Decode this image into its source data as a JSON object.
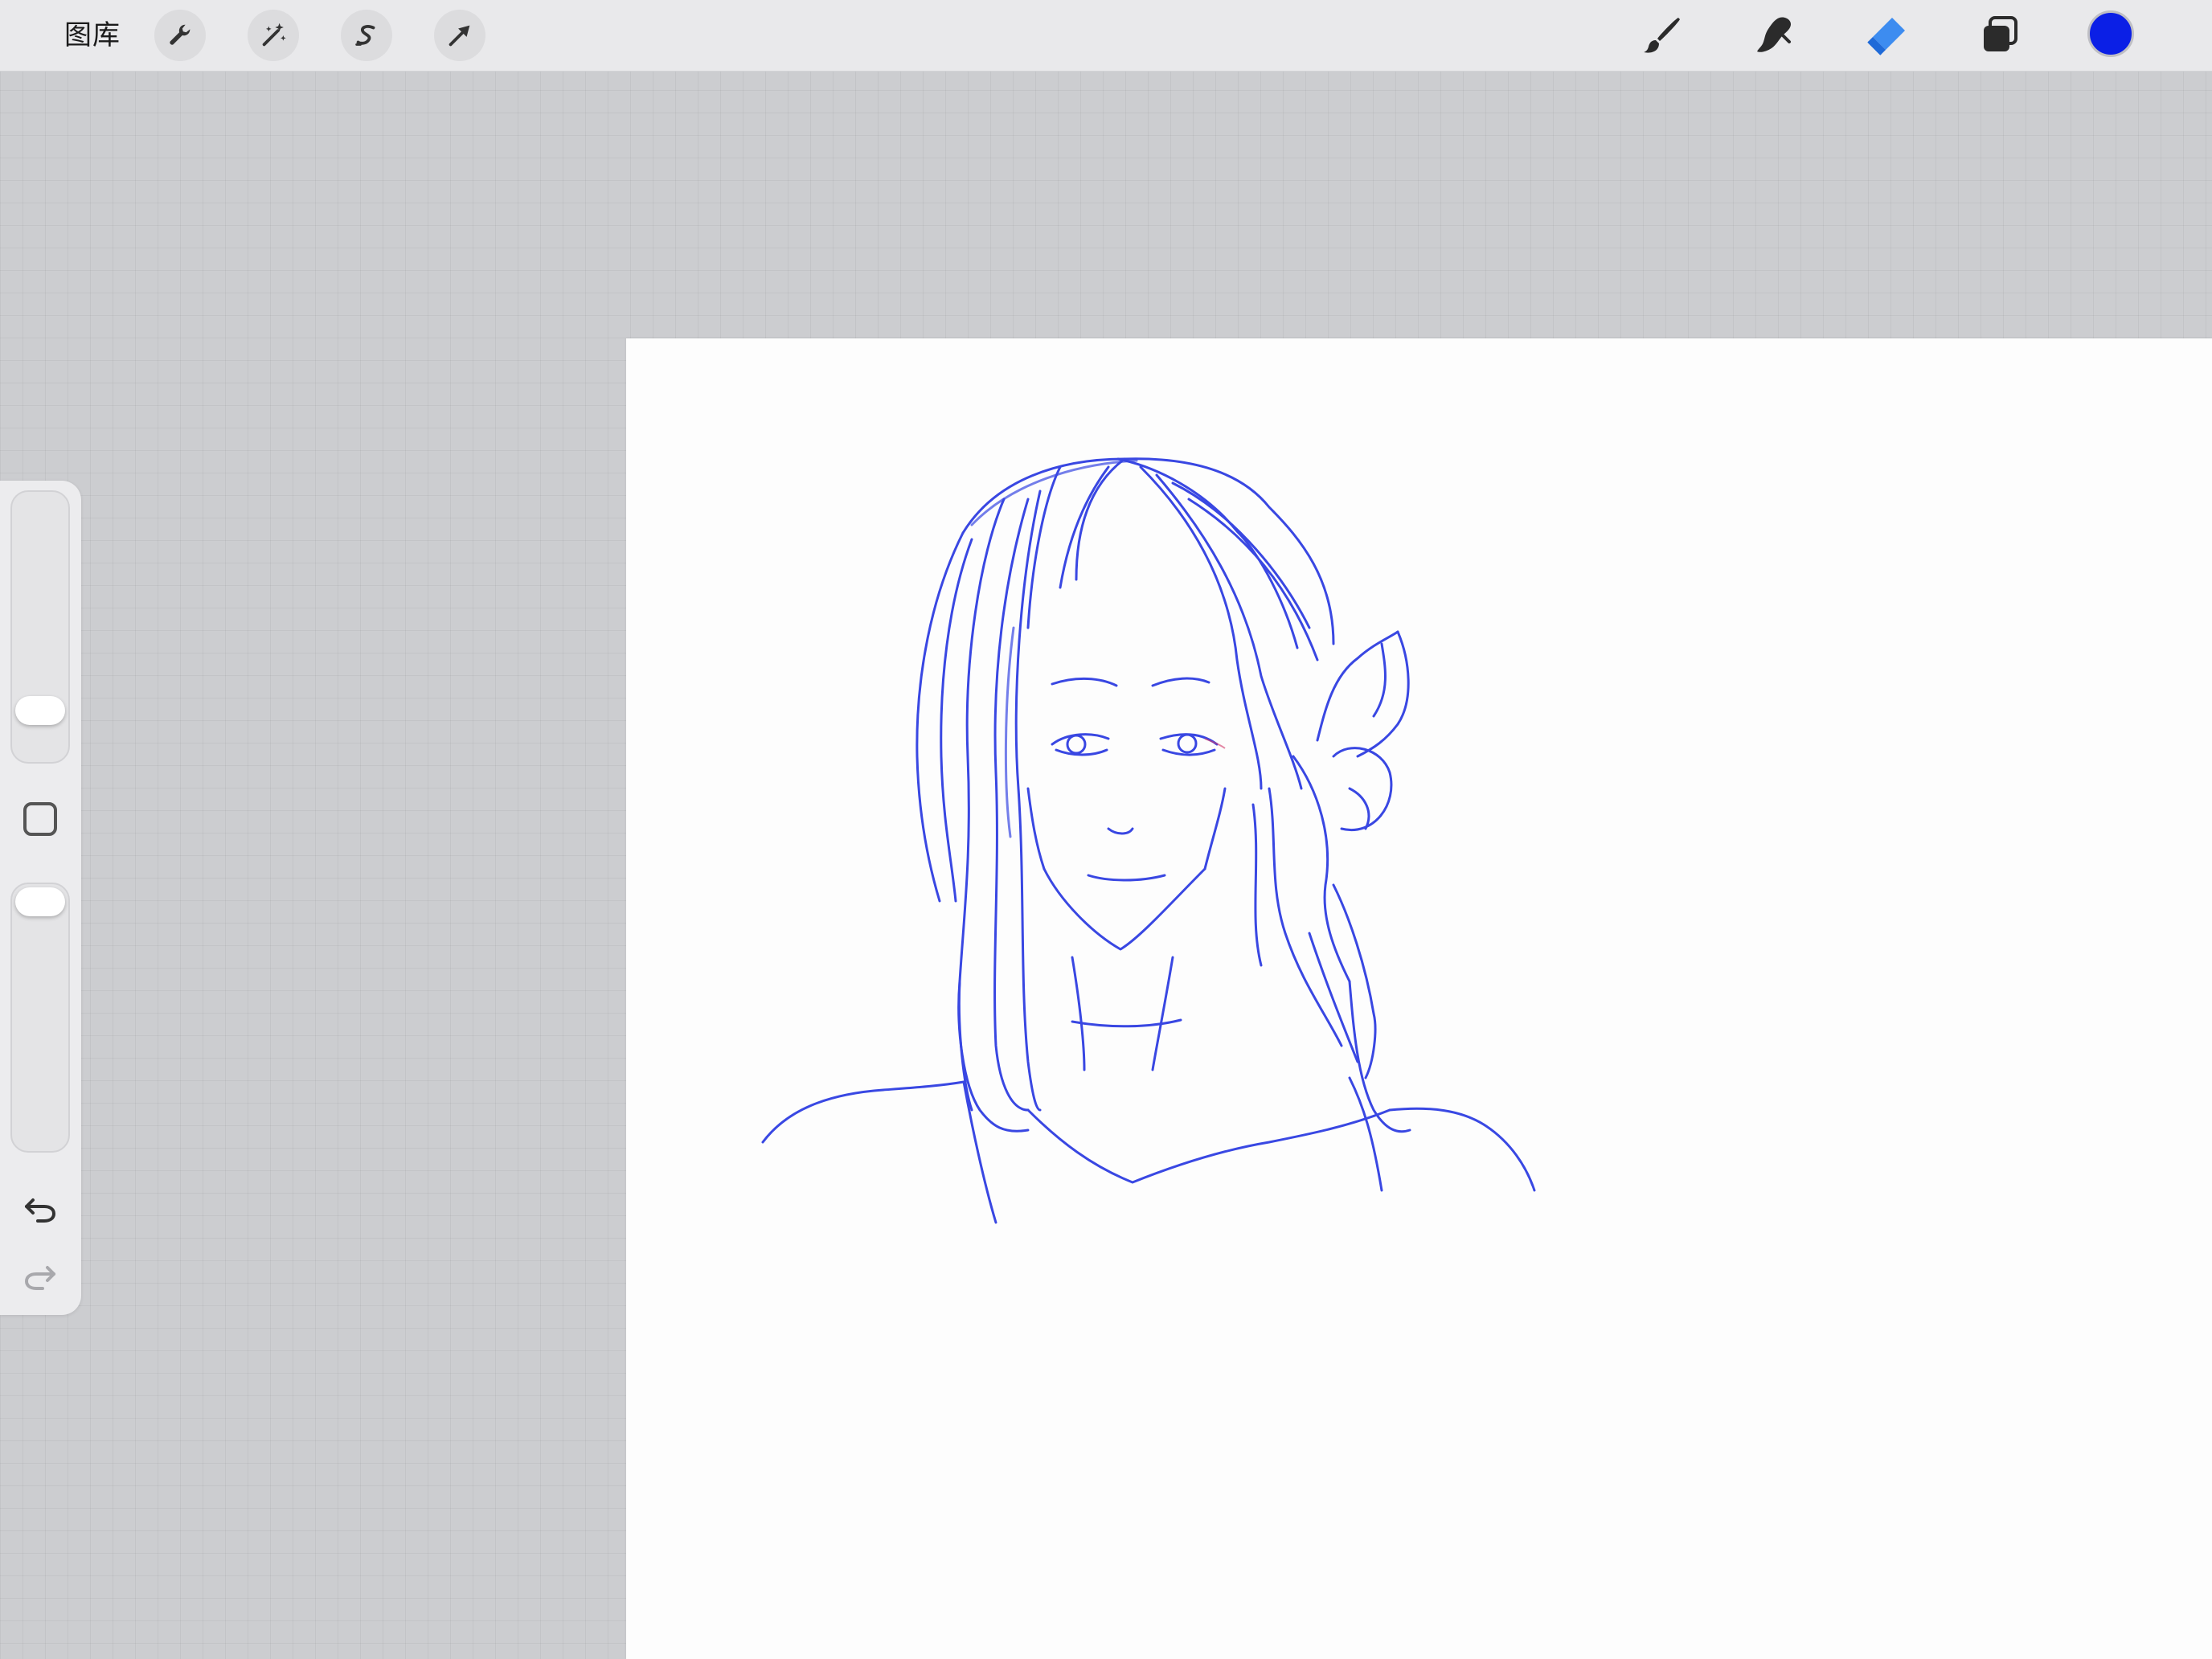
{
  "toolbar": {
    "gallery_label": "图库",
    "left_tools": [
      "wrench-icon",
      "magic-wand-icon",
      "selection-s-icon",
      "transform-arrow-icon"
    ],
    "right_tools": [
      "brush-icon",
      "smudge-icon",
      "eraser-icon",
      "layers-icon"
    ],
    "active_tool": "eraser",
    "current_color": "#0b1fe6"
  },
  "sidebar": {
    "brush_size_fraction": 0.25,
    "opacity_fraction": 0.95,
    "controls": [
      "brush-size-slider",
      "modifier-button",
      "opacity-slider",
      "undo-icon",
      "redo-icon"
    ]
  },
  "canvas": {
    "background": "#fdfdfd",
    "stroke_color": "#2434e0",
    "content": "sketch"
  }
}
